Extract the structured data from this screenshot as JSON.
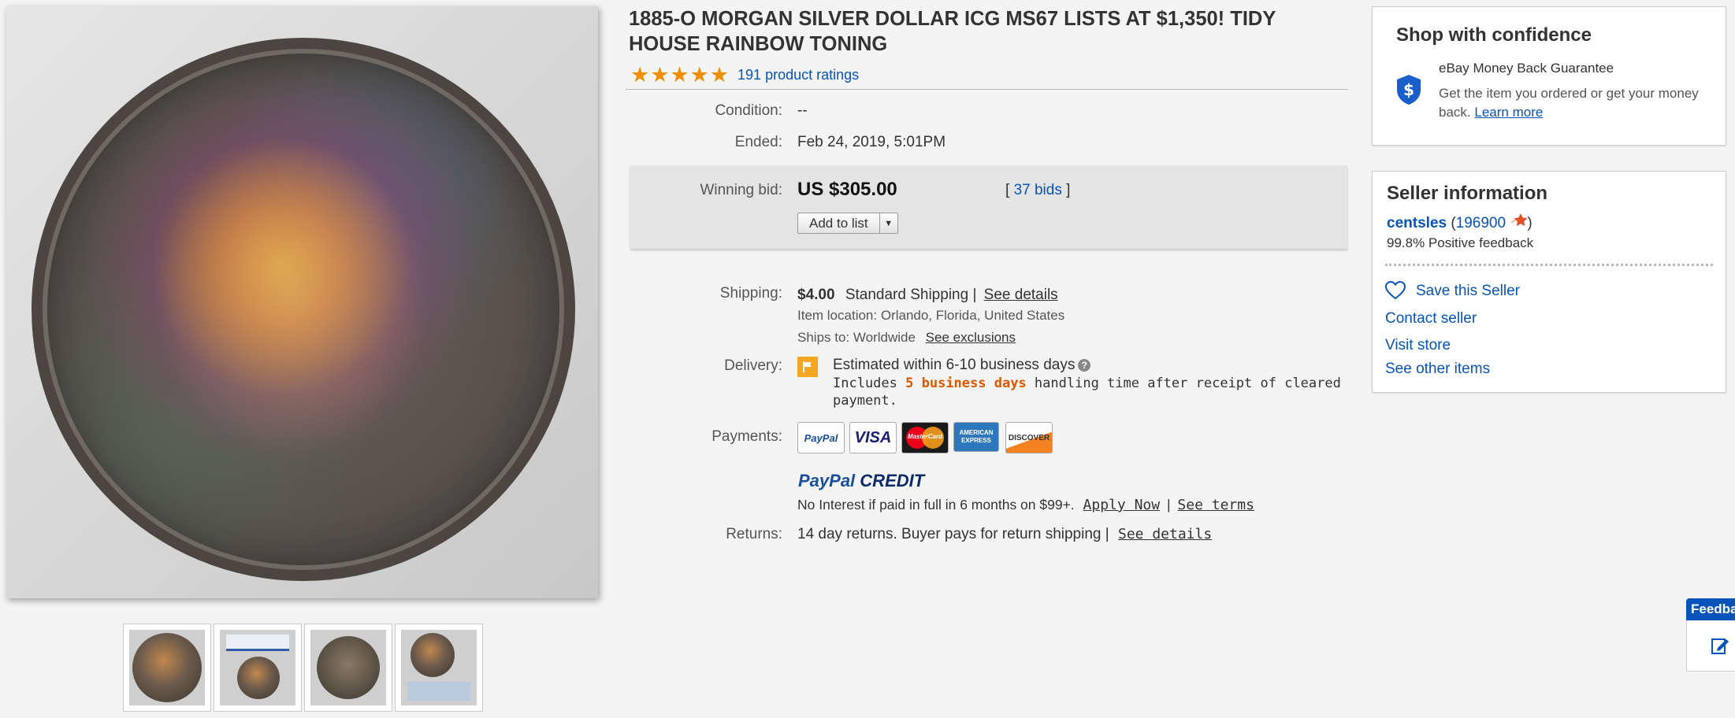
{
  "listing": {
    "title": "1885-O MORGAN SILVER DOLLAR ICG MS67 LISTS AT $1,350! TIDY HOUSE RAINBOW TONING",
    "rating_stars": 5,
    "stars_text": "★★★★★",
    "ratings_link": "191 product ratings"
  },
  "details": {
    "condition_label": "Condition:",
    "condition_value": "--",
    "ended_label": "Ended:",
    "ended_value": "Feb 24, 2019, 5:01PM",
    "winning_bid_label": "Winning bid:",
    "winning_bid_value": "US $305.00",
    "bids_open": "[",
    "bids_link": "37 bids",
    "bids_close": "]",
    "add_to_list": "Add to list"
  },
  "shipping": {
    "label": "Shipping:",
    "cost": "$4.00",
    "service": "Standard Shipping |",
    "see_details": "See details",
    "item_location": "Item location:  Orlando, Florida, United States",
    "ships_to": "Ships to:  Worldwide",
    "see_exclusions": "See exclusions"
  },
  "delivery": {
    "label": "Delivery:",
    "estimate": "Estimated within 6-10 business days",
    "includes": "Includes",
    "handling_days": "5 business days",
    "handling_rest": "handling time after receipt of cleared",
    "payment_word": "payment."
  },
  "payments": {
    "label": "Payments:",
    "logos": [
      "PayPal",
      "VISA",
      "MasterCard",
      "AMERICAN EXPRESS",
      "DISCOVER"
    ],
    "paypal_credit_1": "PayPal",
    "paypal_credit_2": "CREDIT",
    "credit_text": "No Interest if paid in full in 6 months on $99+.",
    "apply_now": "Apply Now",
    "pipe": "|",
    "see_terms": "See terms"
  },
  "returns": {
    "label": "Returns:",
    "text": "14 day returns. Buyer pays for return shipping |",
    "see_details": "See details"
  },
  "confidence": {
    "heading": "Shop with confidence",
    "guarantee_title": "eBay Money Back Guarantee",
    "guarantee_text": "Get the item you ordered or get your money back.",
    "learn_more": "Learn more"
  },
  "seller": {
    "heading": "Seller information",
    "name": "centsles",
    "score_open": "(",
    "score": "196900",
    "score_close": ")",
    "feedback_pct": "99.8% Positive feedback",
    "save_seller": "Save this Seller",
    "contact": "Contact seller",
    "visit_store": "Visit store",
    "other_items": "See other items"
  },
  "feedback_tab": {
    "label": "Feedback"
  },
  "colors": {
    "link": "#0654ba",
    "star": "#f18e00",
    "handling": "#dd5800",
    "feedback_tab": "#0654ba"
  }
}
